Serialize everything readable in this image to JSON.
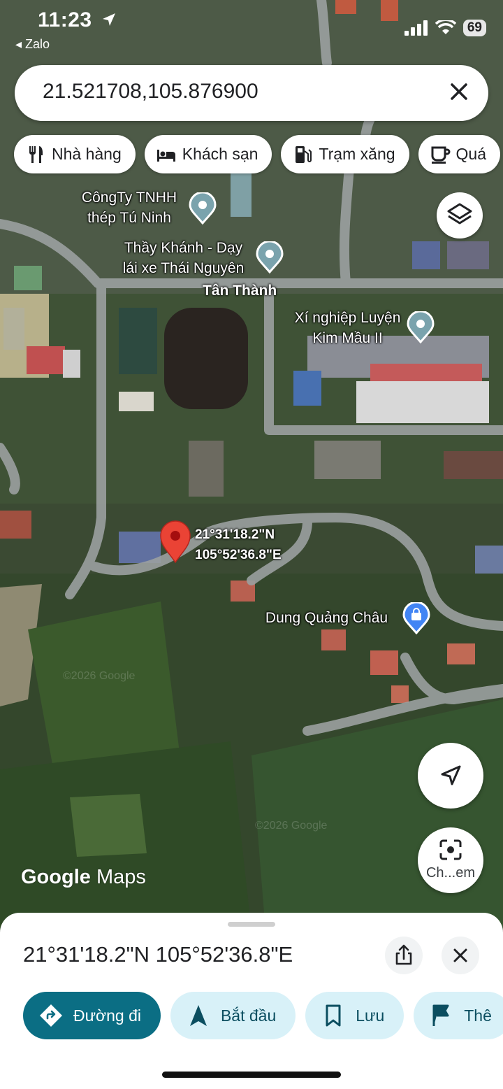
{
  "status_bar": {
    "time": "11:23",
    "back_app": "Zalo",
    "battery": "69"
  },
  "search": {
    "query": "21.521708,105.876900"
  },
  "chips": [
    {
      "label": "Nhà hàng",
      "icon": "restaurant-icon"
    },
    {
      "label": "Khách sạn",
      "icon": "hotel-icon"
    },
    {
      "label": "Trạm xăng",
      "icon": "gas-station-icon"
    },
    {
      "label": "Quá",
      "icon": "cafe-icon"
    }
  ],
  "map": {
    "pois": [
      {
        "line1": "CôngTy TNHH",
        "line2": "thép Tú Ninh"
      },
      {
        "line1": "Thầy Khánh - Dạy",
        "line2": "lái xe Thái Nguyên"
      },
      {
        "line1": "Xí nghiệp Luyện",
        "line2": "Kim Mầu II"
      },
      {
        "line1": "Dung Quảng Châu",
        "line2": ""
      }
    ],
    "area_label": "Tân Thành",
    "pin": {
      "lat": "21°31'18.2\"N",
      "lng": "105°52'36.8\"E"
    },
    "watermark": "©2026 Google",
    "logo_google": "Google",
    "logo_maps": "Maps"
  },
  "lens_label": "Ch...em",
  "sheet": {
    "coordinates": "21°31'18.2\"N 105°52'36.8\"E",
    "actions": {
      "directions": "Đường đi",
      "start": "Bắt đầu",
      "save": "Lưu",
      "more": "Thê"
    }
  },
  "colors": {
    "accent": "#0b6e84",
    "accent_light": "#d8f1f8",
    "pin_red": "#ea4335",
    "poi_blue": "#4285f4"
  }
}
